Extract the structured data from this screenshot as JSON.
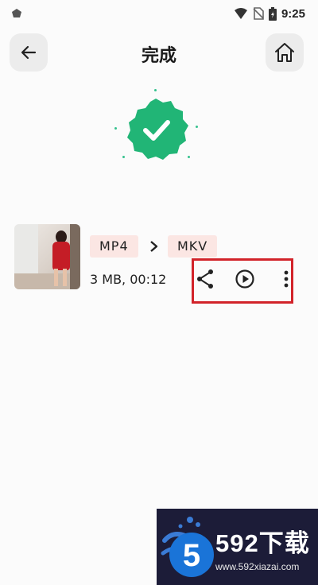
{
  "status_bar": {
    "time": "9:25",
    "icons": [
      "wifi-icon",
      "no-sim-icon",
      "battery-icon"
    ]
  },
  "header": {
    "title": "完成",
    "back_icon": "arrow-left-icon",
    "home_icon": "home-icon"
  },
  "status": {
    "icon": "check-badge-icon",
    "color": "#21b576"
  },
  "file": {
    "source_format": "MP4",
    "target_format": "MKV",
    "meta": "3 MB, 00:12",
    "actions": [
      "share-icon",
      "play-icon",
      "more-vert-icon"
    ]
  },
  "colors": {
    "accent_green": "#21b576",
    "tag_bg": "#fbe6e3",
    "highlight_red": "#d2232a"
  },
  "watermark": {
    "title": "592下载",
    "url": "www.592xiazai.com"
  }
}
